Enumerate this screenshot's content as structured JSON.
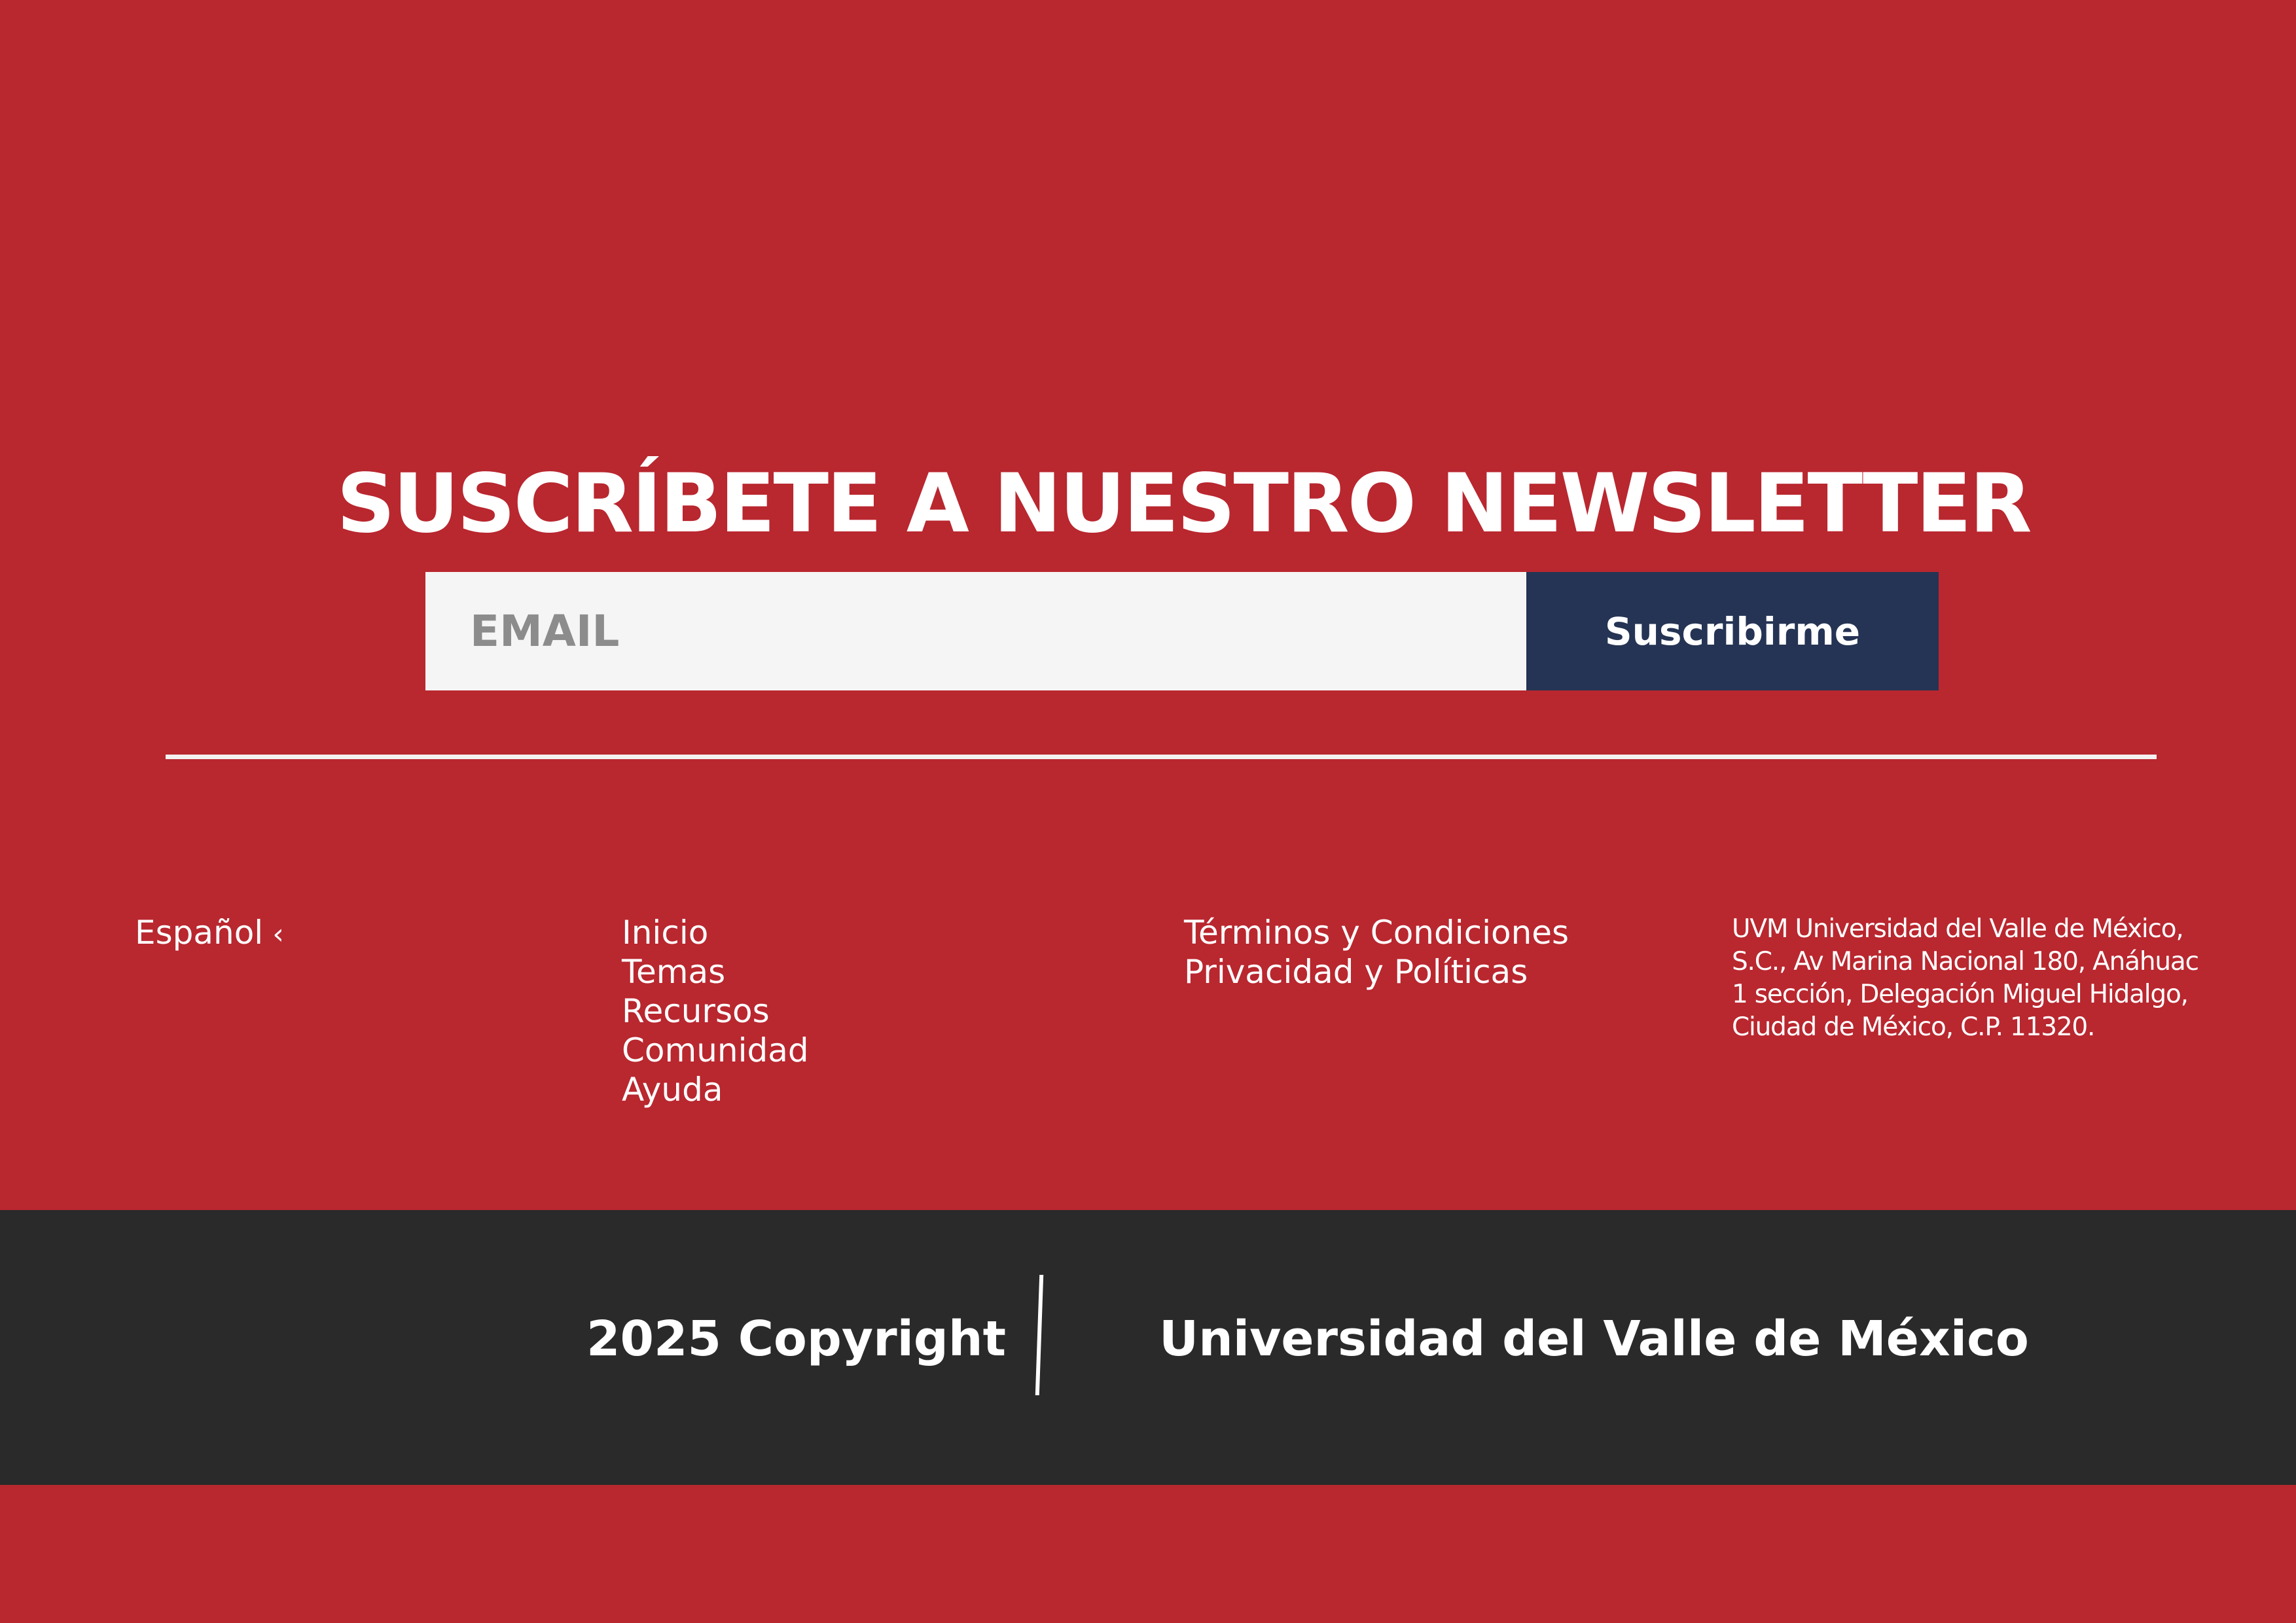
{
  "newsletter": {
    "title": "SUSCRÍBETE A NUESTRO NEWSLETTER",
    "email_placeholder": "EMAIL",
    "email_value": "",
    "subscribe_label": "Suscribirme"
  },
  "footer": {
    "language": {
      "label": "Español",
      "icon": "chevron-left-icon"
    },
    "nav": [
      {
        "label": "Inicio"
      },
      {
        "label": "Temas"
      },
      {
        "label": "Recursos"
      },
      {
        "label": "Comunidad"
      },
      {
        "label": "Ayuda"
      }
    ],
    "legal": [
      {
        "label": "Términos y Condiciones"
      },
      {
        "label": "Privacidad y Políticas"
      }
    ],
    "address_lines": [
      "UVM Universidad del Valle de México,",
      "S.C., Av Marina Nacional 180, Anáhuac",
      "1 sección, Delegación Miguel Hidalgo,",
      "Ciudad de México, C.P. 11320."
    ]
  },
  "bottom_bar": {
    "copyright": "2025 Copyright",
    "university": "Universidad del Valle de México"
  },
  "colors": {
    "background": "#b9272f",
    "button": "#253454",
    "input": "#f6f5f6",
    "bottom_bar": "#2a2a2a",
    "text": "#ffffff"
  }
}
